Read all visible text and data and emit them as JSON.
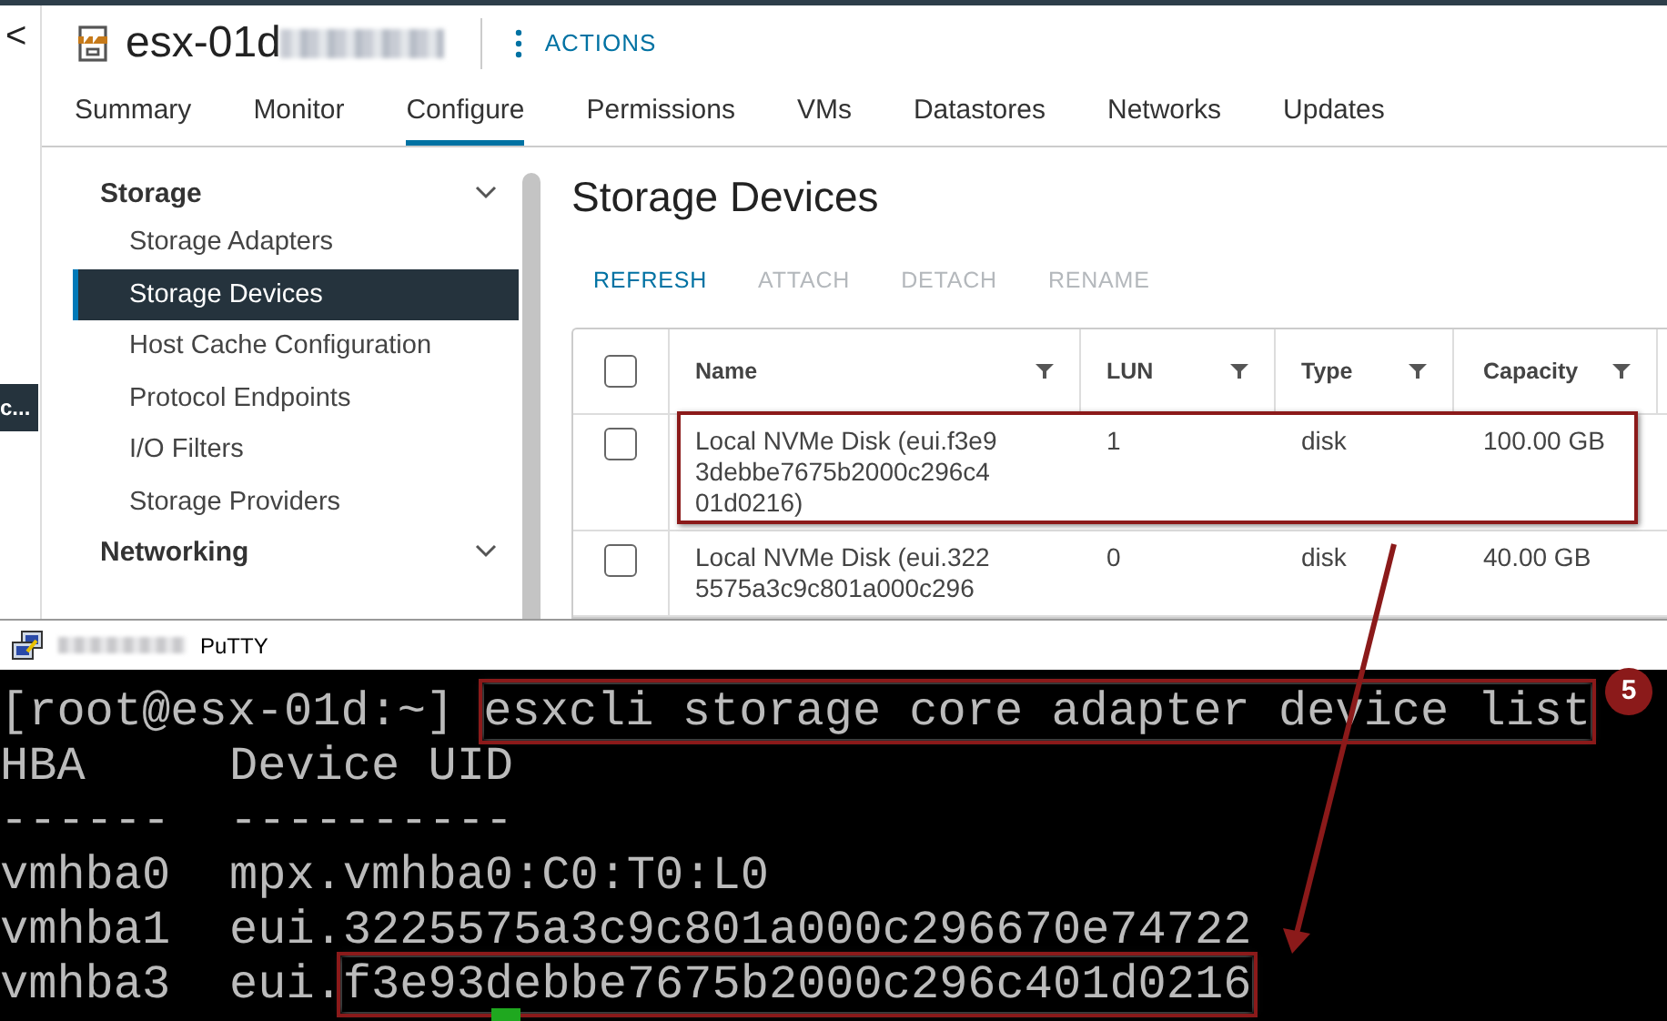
{
  "left_rail": {
    "back_glyph": "<",
    "badge": "c..."
  },
  "host": {
    "name": "esx-01d",
    "actions": "ACTIONS"
  },
  "tabs": [
    {
      "label": "Summary",
      "selected": false
    },
    {
      "label": "Monitor",
      "selected": false
    },
    {
      "label": "Configure",
      "selected": true
    },
    {
      "label": "Permissions",
      "selected": false
    },
    {
      "label": "VMs",
      "selected": false
    },
    {
      "label": "Datastores",
      "selected": false
    },
    {
      "label": "Networks",
      "selected": false
    },
    {
      "label": "Updates",
      "selected": false
    }
  ],
  "sidebar": {
    "groups": [
      {
        "label": "Storage",
        "expanded": true,
        "items": [
          {
            "label": "Storage Adapters",
            "selected": false
          },
          {
            "label": "Storage Devices",
            "selected": true
          },
          {
            "label": "Host Cache Configuration",
            "selected": false
          },
          {
            "label": "Protocol Endpoints",
            "selected": false
          },
          {
            "label": "I/O Filters",
            "selected": false
          },
          {
            "label": "Storage Providers",
            "selected": false
          }
        ]
      },
      {
        "label": "Networking",
        "expanded": true
      }
    ]
  },
  "page_title": "Storage Devices",
  "toolbar": [
    {
      "label": "REFRESH",
      "disabled": false
    },
    {
      "label": "ATTACH",
      "disabled": true
    },
    {
      "label": "DETACH",
      "disabled": true
    },
    {
      "label": "RENAME",
      "disabled": true
    }
  ],
  "table": {
    "select_all": {
      "checked": false
    },
    "columns": [
      "Name",
      "LUN",
      "Type",
      "Capacity"
    ],
    "rows": [
      {
        "checked": false,
        "highlighted": true,
        "cells": [
          "Local NVMe Disk (eui.f3e93debbe7675b2000c296c401d0216)",
          "1",
          "disk",
          "100.00 GB"
        ]
      },
      {
        "checked": false,
        "highlighted": false,
        "cells": [
          "Local NVMe Disk (eui.322\n5575a3c9c801a000c296",
          "0",
          "disk",
          "40.00 GB"
        ]
      }
    ]
  },
  "terminal": {
    "title": "PuTTY",
    "badge": "5",
    "prompt": "[root@esx-01d:~]",
    "command": "esxcli storage core adapter device list",
    "lines": [
      {
        "kind": "text",
        "cols": [
          "HBA",
          "Device UID"
        ]
      },
      {
        "kind": "text",
        "cols": [
          "------",
          "----------"
        ]
      },
      {
        "kind": "text",
        "cols": [
          "vmhba0",
          "mpx.vmhba0:C0:T0:L0"
        ]
      },
      {
        "kind": "text",
        "cols": [
          "vmhba1",
          "eui.3225575a3c9c801a000c296670e74722"
        ]
      },
      {
        "kind": "highlight",
        "cols": [
          "vmhba3",
          "eui.",
          "f3e93debbe7675b2000c296c401d0216"
        ]
      }
    ]
  }
}
